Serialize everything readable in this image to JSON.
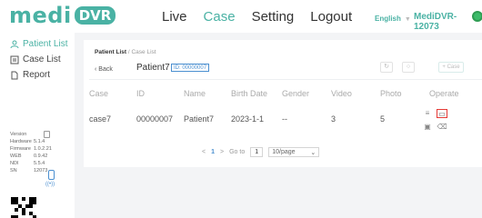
{
  "header": {
    "logo_medi": "medi",
    "logo_dvr": "DVR",
    "nav": [
      {
        "label": "Live",
        "active": false
      },
      {
        "label": "Case",
        "active": true
      },
      {
        "label": "Setting",
        "active": false
      },
      {
        "label": "Logout",
        "active": false
      }
    ],
    "language": "English",
    "device_name": "MediDVR-12073",
    "accent_color": "#4ab2a4"
  },
  "sidebar": {
    "items": [
      {
        "label": "Patient List",
        "icon": "patient-icon",
        "active": true
      },
      {
        "label": "Case List",
        "icon": "list-icon",
        "active": false
      },
      {
        "label": "Report",
        "icon": "report-icon",
        "active": false
      }
    ],
    "sysinfo": [
      {
        "key": "Version",
        "value": ""
      },
      {
        "key": "Hardware",
        "value": "5.1.4"
      },
      {
        "key": "Firmware",
        "value": "1.0.2.21"
      },
      {
        "key": "WEB",
        "value": "0.9.42"
      },
      {
        "key": "NDI",
        "value": "5.5.4"
      },
      {
        "key": "SN",
        "value": "12073"
      }
    ]
  },
  "main": {
    "breadcrumb": {
      "root": "Patient List",
      "sep": "/",
      "current": "Case List"
    },
    "back_label": "Back",
    "patient_name": "Patient7",
    "id_badge": "ID: 00000007",
    "add_case_label": "+ Case",
    "table": {
      "columns": [
        "Case",
        "ID",
        "Name",
        "Birth Date",
        "Gender",
        "Video",
        "Photo",
        "Operate"
      ],
      "rows": [
        {
          "case": "case7",
          "id": "00000007",
          "name": "Patient7",
          "birth": "2023-1-1",
          "gender": "--",
          "video": "3",
          "photo": "5"
        }
      ]
    },
    "pagination": {
      "prev": "<",
      "page": "1",
      "next": ">",
      "goto_label": "Go to",
      "goto_value": "1",
      "page_size": "10/page"
    }
  }
}
